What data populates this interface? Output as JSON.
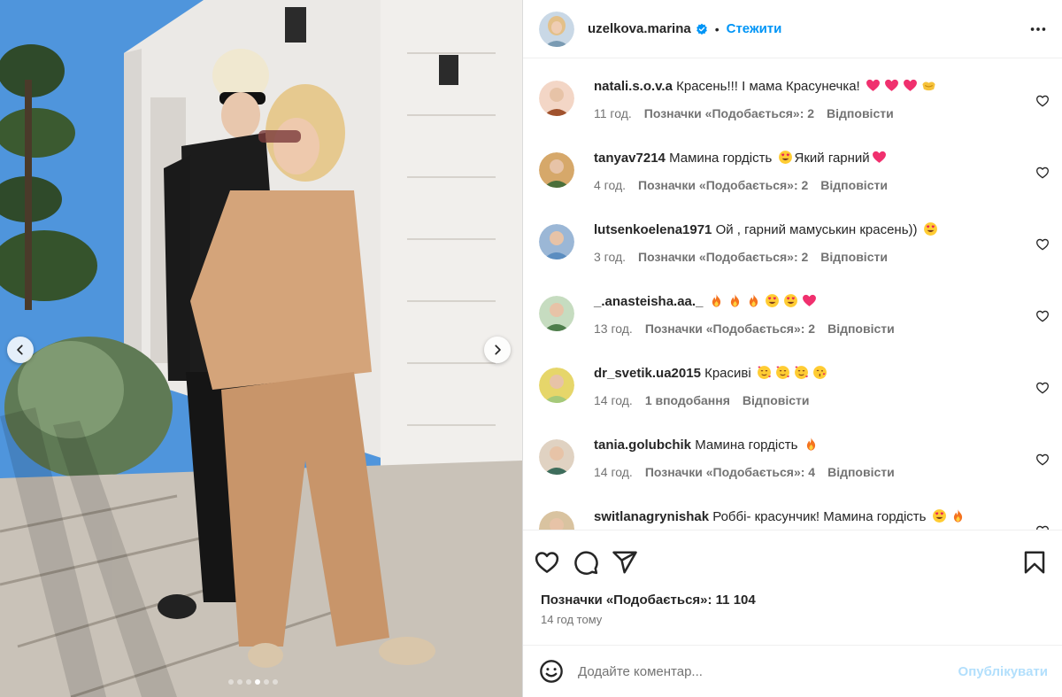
{
  "post": {
    "author": "uzelkova.marina",
    "separator": "•",
    "follow_label": "Стежити",
    "carousel": {
      "slide_count": 6,
      "active_index": 3
    }
  },
  "comments": [
    {
      "user": "natali.s.o.v.a",
      "text": "Красень!!! І мама Красунечка!",
      "emojis": [
        "heart",
        "heart",
        "heart",
        "hands"
      ],
      "time": "11 год.",
      "likes": "Позначки «Подобається»: 2",
      "reply": "Відповісти"
    },
    {
      "user": "tanyav7214",
      "text": "Мамина гордість",
      "emojis_mid": [
        "heart-eyes"
      ],
      "text2": "Який гарний",
      "emojis": [
        "heart"
      ],
      "time": "4 год.",
      "likes": "Позначки «Подобається»: 2",
      "reply": "Відповісти"
    },
    {
      "user": "lutsenkoelena1971",
      "text": "Ой , гарний мамуськин красень))",
      "emojis": [
        "heart-eyes"
      ],
      "time": "3 год.",
      "likes": "Позначки «Подобається»: 2",
      "reply": "Відповісти"
    },
    {
      "user": "_.anasteisha.aa._",
      "text": "",
      "emojis": [
        "fire",
        "fire",
        "fire",
        "heart-eyes",
        "heart-eyes",
        "heart"
      ],
      "time": "13 год.",
      "likes": "Позначки «Подобається»: 2",
      "reply": "Відповісти"
    },
    {
      "user": "dr_svetik.ua2015",
      "text": "Красиві",
      "emojis": [
        "smiling-hearts",
        "smiling-hearts",
        "smiling-hearts",
        "kiss"
      ],
      "time": "14 год.",
      "likes": "1 вподобання",
      "reply": "Відповісти"
    },
    {
      "user": "tania.golubchik",
      "text": "Мамина гордість",
      "emojis": [
        "fire"
      ],
      "time": "14 год.",
      "likes": "Позначки «Подобається»: 4",
      "reply": "Відповісти"
    },
    {
      "user": "switlanagrynishak",
      "text": "Роббі- красунчик! Мамина гордість",
      "emojis": [
        "heart-eyes",
        "fire"
      ],
      "time": "",
      "likes": "",
      "reply": ""
    }
  ],
  "footer": {
    "likes_text": "Позначки «Подобається»: 11 104",
    "time_ago": "14 год тому",
    "comment_placeholder": "Додайте коментар...",
    "publish_label": "Опублікувати"
  },
  "colors": {
    "accent": "#0095f6",
    "publish_disabled": "#b2dffc",
    "muted": "#737373",
    "text": "#262626"
  }
}
